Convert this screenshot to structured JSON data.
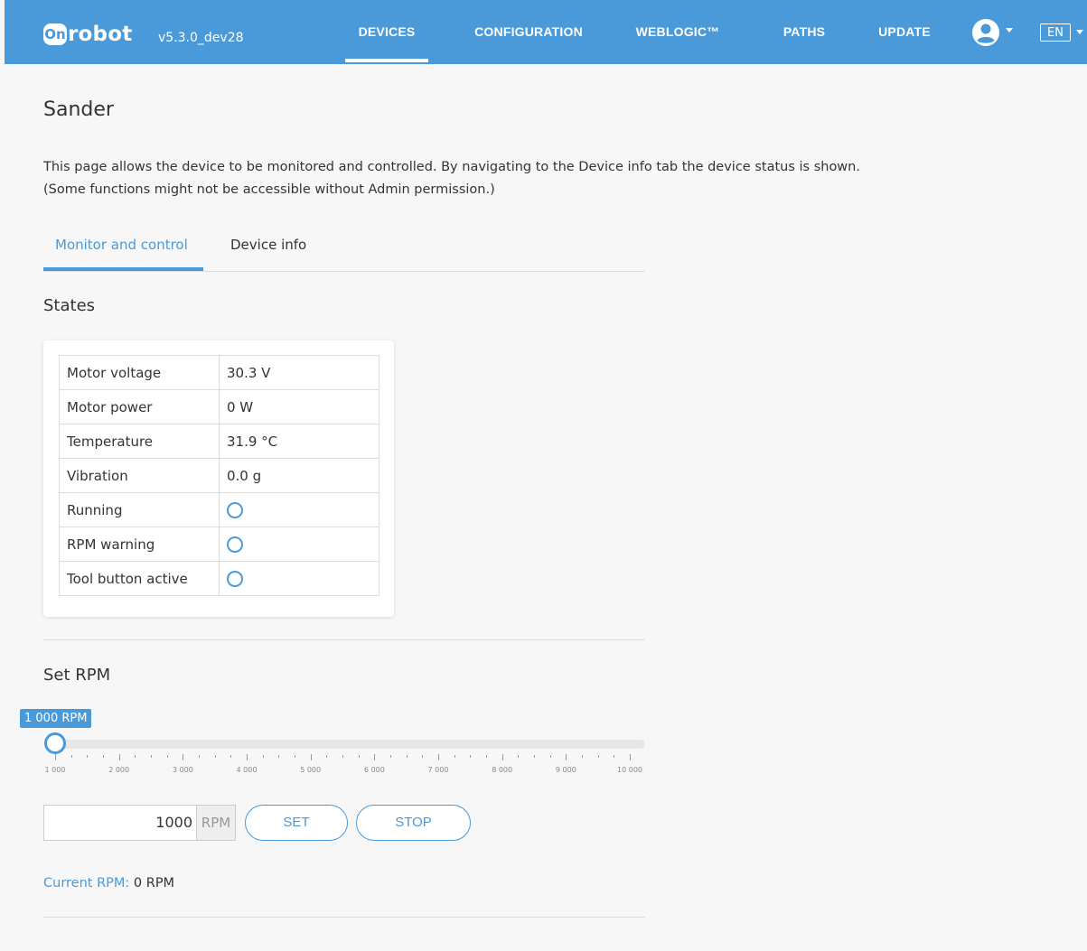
{
  "header": {
    "logo_badge": "On",
    "logo_word": "robot",
    "version": "v5.3.0_dev28",
    "nav": [
      "DEVICES",
      "CONFIGURATION",
      "WEBLOGIC™",
      "PATHS",
      "UPDATE"
    ],
    "active_nav": "DEVICES",
    "language": "EN",
    "user_icon": "user-circle-icon"
  },
  "page": {
    "title": "Sander",
    "description_line1": "This page allows the device to be monitored and controlled. By navigating to the Device info tab the device status is shown.",
    "description_line2": "(Some functions might not be accessible without Admin permission.)"
  },
  "tabs": {
    "items": [
      "Monitor and control",
      "Device info"
    ],
    "active": "Monitor and control"
  },
  "states": {
    "title": "States",
    "rows": [
      {
        "label": "Motor voltage",
        "value": "30.3 V"
      },
      {
        "label": "Motor power",
        "value": "0 W"
      },
      {
        "label": "Temperature",
        "value": "31.9 °C"
      },
      {
        "label": "Vibration",
        "value": "0.0 g"
      },
      {
        "label": "Running",
        "indicator": "off"
      },
      {
        "label": "RPM warning",
        "indicator": "off"
      },
      {
        "label": "Tool button active",
        "indicator": "off"
      }
    ]
  },
  "set_rpm": {
    "title": "Set RPM",
    "slider": {
      "tooltip": "1 000 RPM",
      "min": 1000,
      "max": 10000,
      "value": 1000,
      "tick_labels": [
        "1 000",
        "2 000",
        "3 000",
        "4 000",
        "5 000",
        "6 000",
        "7 000",
        "8 000",
        "9 000",
        "10 000"
      ]
    },
    "input_value": "1000",
    "input_unit": "RPM",
    "set_label": "SET",
    "stop_label": "STOP",
    "current_label": "Current RPM:",
    "current_value": "0 RPM"
  },
  "colors": {
    "primary": "#4a9ad9",
    "background": "#f7f7f7"
  }
}
